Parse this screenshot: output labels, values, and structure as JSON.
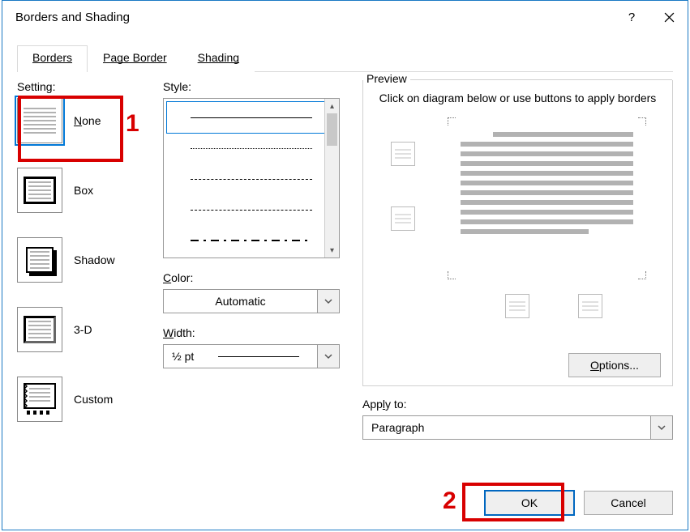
{
  "title": "Borders and Shading",
  "tabs": {
    "borders": "Borders",
    "page_border": "Page Border",
    "shading": "Shading"
  },
  "setting": {
    "label": "Setting:",
    "items": [
      {
        "name": "None"
      },
      {
        "name": "Box"
      },
      {
        "name": "Shadow"
      },
      {
        "name": "3-D"
      },
      {
        "name": "Custom"
      }
    ]
  },
  "style": {
    "label": "Style:"
  },
  "color": {
    "label": "Color:",
    "value": "Automatic"
  },
  "width": {
    "label": "Width:",
    "value": "½ pt"
  },
  "preview": {
    "label": "Preview",
    "hint": "Click on diagram below or use buttons to apply borders"
  },
  "apply_to": {
    "label": "Apply to:",
    "value": "Paragraph"
  },
  "buttons": {
    "options": "Options...",
    "ok": "OK",
    "cancel": "Cancel"
  },
  "markers": {
    "one": "1",
    "two": "2"
  }
}
